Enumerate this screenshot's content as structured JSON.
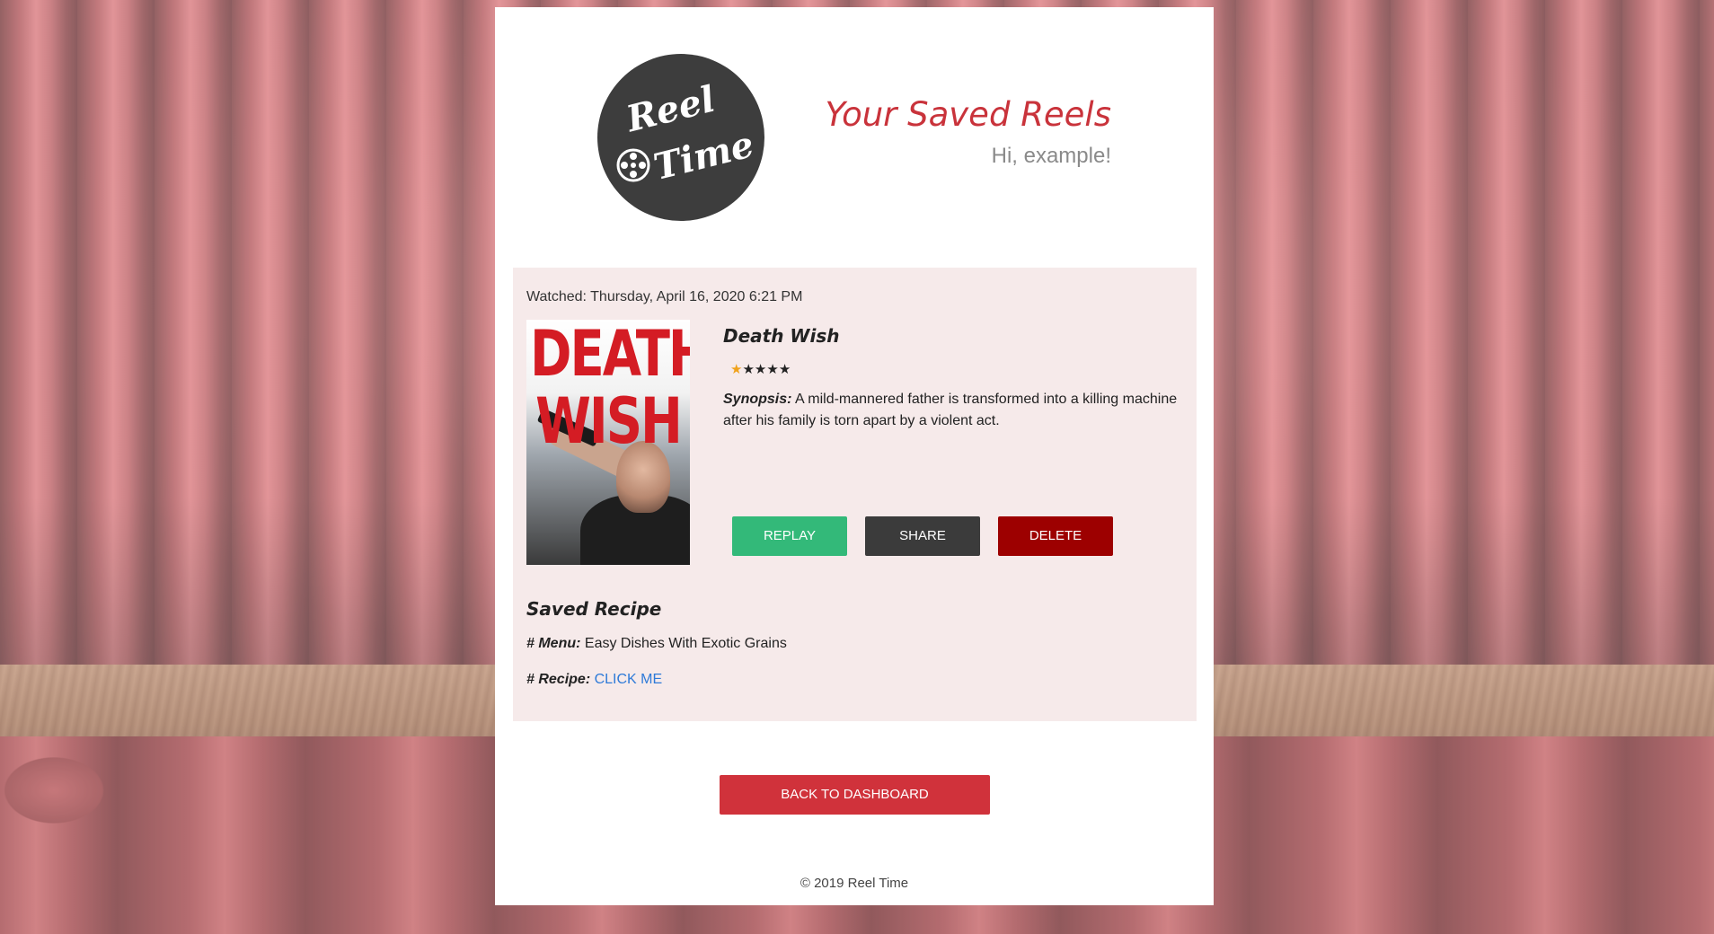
{
  "header": {
    "logo_line1": "Reel",
    "logo_line2": "Time",
    "title": "Your Saved Reels",
    "greeting": "Hi, example!"
  },
  "reel": {
    "watched": "Watched: Thursday, April 16, 2020 6:21 PM",
    "poster_text": "DEATH WISH",
    "movie_title": "Death Wish",
    "rating": 1,
    "rating_max": 5,
    "synopsis_label": "Synopsis:",
    "synopsis": "A mild-mannered father is transformed into a killing machine after his family is torn apart by a violent act.",
    "buttons": {
      "replay": "REPLAY",
      "share": "SHARE",
      "delete": "DELETE"
    },
    "recipe": {
      "heading": "Saved Recipe",
      "menu_label": "# Menu:",
      "menu_value": "Easy Dishes With Exotic Grains",
      "recipe_label": "# Recipe:",
      "recipe_link": "CLICK ME"
    }
  },
  "nav": {
    "back": "BACK TO DASHBOARD"
  },
  "footer": {
    "copyright": "© 2019 Reel Time"
  },
  "colors": {
    "accent": "#c9333b",
    "replay": "#33b979",
    "share": "#3b3b3b",
    "delete": "#9d0000",
    "back": "#d0323b",
    "link": "#2e7ad8",
    "star": "#f0a21c"
  }
}
